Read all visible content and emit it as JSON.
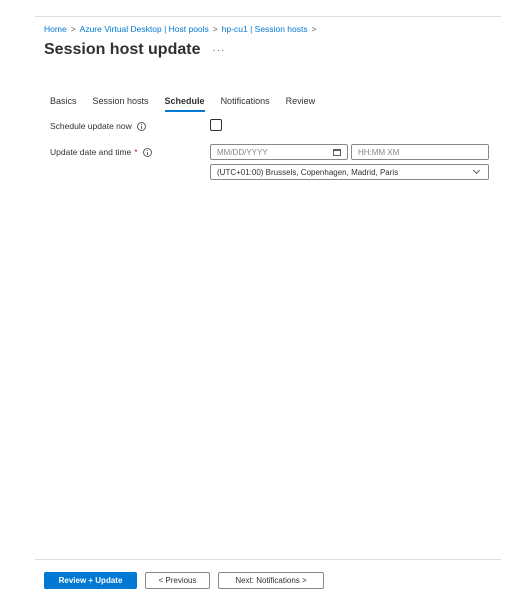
{
  "breadcrumb": {
    "items": [
      "Home",
      "Azure Virtual Desktop | Host pools",
      "hp-cu1 | Session hosts"
    ],
    "separator": ">"
  },
  "page": {
    "title": "Session host update",
    "more": "···"
  },
  "tabs": [
    {
      "label": "Basics",
      "active": false
    },
    {
      "label": "Session hosts",
      "active": false
    },
    {
      "label": "Schedule",
      "active": true
    },
    {
      "label": "Notifications",
      "active": false
    },
    {
      "label": "Review",
      "active": false
    }
  ],
  "form": {
    "schedule_now_label": "Schedule update now",
    "schedule_now_checked": false,
    "update_datetime_label": "Update date and time",
    "required_mark": "*",
    "date_placeholder": "MM/DD/YYYY",
    "time_placeholder": "HH:MM XM",
    "timezone_value": "(UTC+01:00) Brussels, Copenhagen, Madrid, Paris"
  },
  "footer": {
    "primary_label": "Review + Update",
    "previous_label": "< Previous",
    "next_label": "Next: Notifications >"
  },
  "colors": {
    "accent": "#0078d4",
    "required": "#a4262c",
    "text": "#323130",
    "border": "#8a8886"
  }
}
